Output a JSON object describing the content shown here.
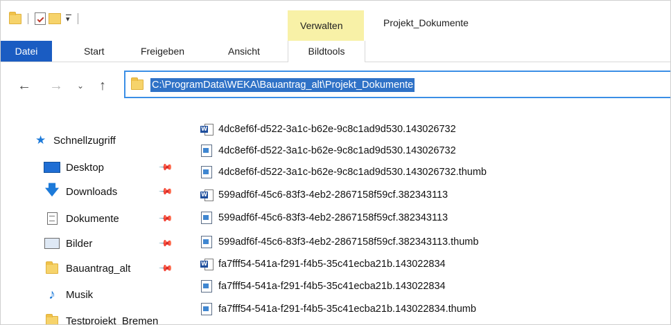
{
  "window": {
    "title": "Projekt_Dokumente",
    "context_tab_group": "Verwalten"
  },
  "ribbon": {
    "tabs": [
      {
        "label": "Datei"
      },
      {
        "label": "Start"
      },
      {
        "label": "Freigeben"
      },
      {
        "label": "Ansicht"
      },
      {
        "label": "Bildtools"
      }
    ]
  },
  "address": {
    "path": "C:\\ProgramData\\WEKA\\Bauantrag_alt\\Projekt_Dokumente"
  },
  "sidebar": {
    "quick_access_label": "Schnellzugriff",
    "items": [
      {
        "label": "Desktop",
        "icon": "desktop-icon"
      },
      {
        "label": "Downloads",
        "icon": "download-icon"
      },
      {
        "label": "Dokumente",
        "icon": "documents-icon"
      },
      {
        "label": "Bilder",
        "icon": "pictures-icon"
      },
      {
        "label": "Bauantrag_alt",
        "icon": "folder-icon"
      },
      {
        "label": "Musik",
        "icon": "music-icon"
      },
      {
        "label": "Testprojekt_Bremen",
        "icon": "folder-icon"
      }
    ]
  },
  "files": [
    {
      "name": "4dc8ef6f-d522-3a1c-b62e-9c8c1ad9d530.143026732",
      "icon": "word-document-icon"
    },
    {
      "name": "4dc8ef6f-d522-3a1c-b62e-9c8c1ad9d530.143026732",
      "icon": "image-file-icon"
    },
    {
      "name": "4dc8ef6f-d522-3a1c-b62e-9c8c1ad9d530.143026732.thumb",
      "icon": "image-file-icon"
    },
    {
      "name": "599adf6f-45c6-83f3-4eb2-2867158f59cf.382343113",
      "icon": "word-document-icon"
    },
    {
      "name": "599adf6f-45c6-83f3-4eb2-2867158f59cf.382343113",
      "icon": "image-file-icon"
    },
    {
      "name": "599adf6f-45c6-83f3-4eb2-2867158f59cf.382343113.thumb",
      "icon": "image-file-icon"
    },
    {
      "name": "fa7fff54-541a-f291-f4b5-35c41ecba21b.143022834",
      "icon": "word-document-icon"
    },
    {
      "name": "fa7fff54-541a-f291-f4b5-35c41ecba21b.143022834",
      "icon": "image-file-icon"
    },
    {
      "name": "fa7fff54-541a-f291-f4b5-35c41ecba21b.143022834.thumb",
      "icon": "image-file-icon"
    }
  ]
}
